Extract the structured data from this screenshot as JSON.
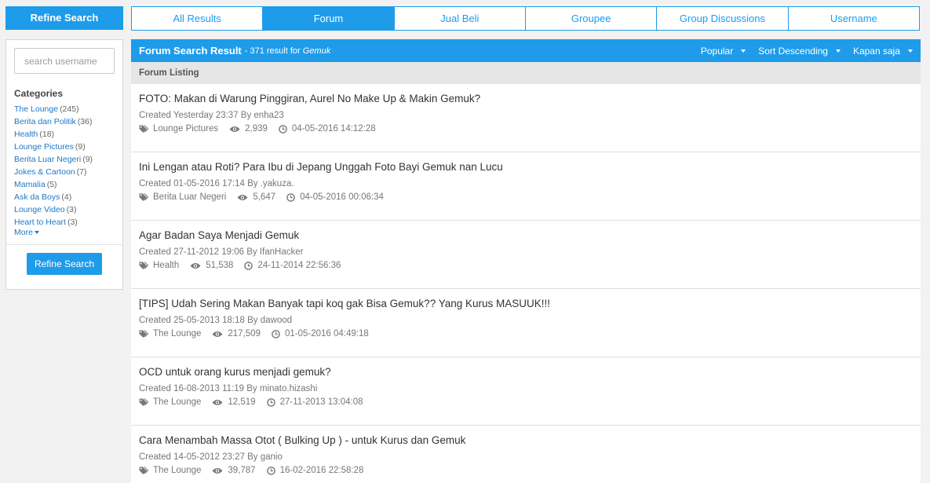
{
  "sidebar": {
    "header": "Refine Search",
    "search_placeholder": "search username",
    "categories_title": "Categories",
    "categories": [
      {
        "name": "The Lounge",
        "count": "(245)"
      },
      {
        "name": "Berita dan Politik",
        "count": "(36)"
      },
      {
        "name": "Health",
        "count": "(18)"
      },
      {
        "name": "Lounge Pictures",
        "count": "(9)"
      },
      {
        "name": "Berita Luar Negeri",
        "count": "(9)"
      },
      {
        "name": "Jokes & Cartoon",
        "count": "(7)"
      },
      {
        "name": "Mamalia",
        "count": "(5)"
      },
      {
        "name": "Ask da Boys",
        "count": "(4)"
      },
      {
        "name": "Lounge Video",
        "count": "(3)"
      },
      {
        "name": "Heart to Heart",
        "count": "(3)"
      }
    ],
    "more_label": "More",
    "refine_button": "Refine Search"
  },
  "tabs": [
    {
      "label": "All Results",
      "active": false
    },
    {
      "label": "Forum",
      "active": true
    },
    {
      "label": "Jual Beli",
      "active": false
    },
    {
      "label": "Groupee",
      "active": false
    },
    {
      "label": "Group Discussions",
      "active": false
    },
    {
      "label": "Username",
      "active": false
    }
  ],
  "result": {
    "title": "Forum Search Result",
    "count_text": "- 371 result for",
    "query": "Gemuk",
    "sorts": [
      "Popular",
      "Sort Descending",
      "Kapan saja"
    ]
  },
  "listing_header": "Forum Listing",
  "threads": [
    {
      "title": "FOTO: Makan di Warung Pinggiran, Aurel No Make Up & Makin Gemuk?",
      "created": "Created Yesterday 23:37 By enha23",
      "category": "Lounge Pictures",
      "views": "2,939",
      "last": "04-05-2016 14:12:28"
    },
    {
      "title": "Ini Lengan atau Roti? Para Ibu di Jepang Unggah Foto Bayi Gemuk nan Lucu",
      "created": "Created 01-05-2016 17:14 By .yakuza.",
      "category": "Berita Luar Negeri",
      "views": "5,647",
      "last": "04-05-2016 00:06:34"
    },
    {
      "title": "Agar Badan Saya Menjadi Gemuk",
      "created": "Created 27-11-2012 19:06 By IfanHacker",
      "category": "Health",
      "views": "51,538",
      "last": "24-11-2014 22:56:36"
    },
    {
      "title": "[TIPS] Udah Sering Makan Banyak tapi koq gak Bisa Gemuk?? Yang Kurus MASUUK!!!",
      "created": "Created 25-05-2013 18:18 By dawood",
      "category": "The Lounge",
      "views": "217,509",
      "last": "01-05-2016 04:49:18"
    },
    {
      "title": "OCD untuk orang kurus menjadi gemuk?",
      "created": "Created 16-08-2013 11:19 By minato.hizashi",
      "category": "The Lounge",
      "views": "12,519",
      "last": "27-11-2013 13:04:08"
    },
    {
      "title": "Cara Menambah Massa Otot ( Bulking Up ) - untuk Kurus dan Gemuk",
      "created": "Created 14-05-2012 23:27 By ganio",
      "category": "The Lounge",
      "views": "39,787",
      "last": "16-02-2016 22:58:28"
    }
  ]
}
